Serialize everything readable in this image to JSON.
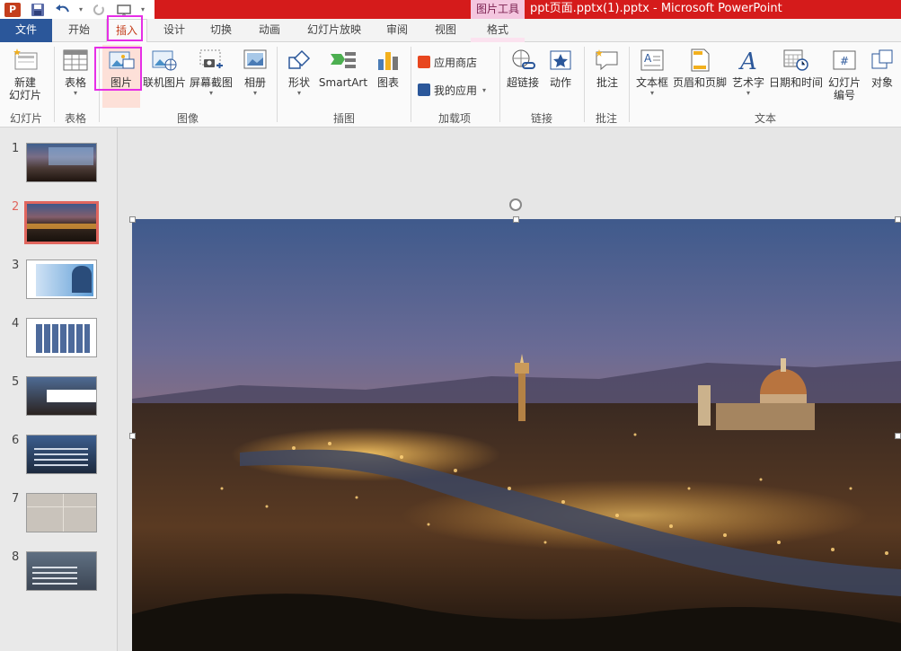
{
  "window": {
    "title": "ppt页面.pptx(1).pptx -  Microsoft PowerPoint",
    "context_tool_label": "图片工具"
  },
  "tabs": {
    "file": "文件",
    "home": "开始",
    "insert": "插入",
    "design": "设计",
    "transitions": "切换",
    "animations": "动画",
    "slideshow": "幻灯片放映",
    "review": "审阅",
    "view": "视图",
    "format": "格式"
  },
  "ribbon": {
    "new_slide": [
      "新建",
      "幻灯片"
    ],
    "table": "表格",
    "picture": "图片",
    "online_picture": "联机图片",
    "screenshot": "屏幕截图",
    "album": "相册",
    "shapes": "形状",
    "smartart": "SmartArt",
    "chart": "图表",
    "store": "应用商店",
    "my_apps": "我的应用",
    "hyperlink": "超链接",
    "action": "动作",
    "comment": "批注",
    "textbox": "文本框",
    "header_footer": "页眉和页脚",
    "wordart": "艺术字",
    "datetime": "日期和时间",
    "slide_number": [
      "幻灯片",
      "编号"
    ],
    "object": "对象",
    "groups": {
      "slides": "幻灯片",
      "tables": "表格",
      "images": "图像",
      "illustrations": "插图",
      "addins": "加载项",
      "links": "链接",
      "comments": "批注",
      "text": "文本"
    }
  },
  "slides": {
    "numbers": [
      "1",
      "2",
      "3",
      "4",
      "5",
      "6",
      "7",
      "8"
    ],
    "selected": "2"
  },
  "colors": {
    "title_red": "#d51b1b",
    "file_blue": "#2b579a",
    "highlight_magenta": "#e62ee6",
    "selected_thumb": "#e0665e"
  }
}
